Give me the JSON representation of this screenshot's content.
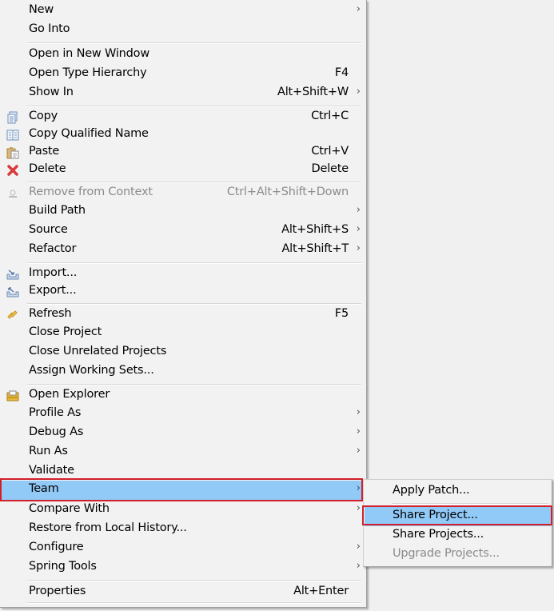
{
  "context_menu": {
    "items": [
      {
        "label": "New",
        "shortcut": "",
        "submenu": true,
        "icon": null,
        "disabled": false
      },
      {
        "label": "Go Into",
        "shortcut": "",
        "submenu": false,
        "icon": null,
        "disabled": false
      },
      {
        "label": "Open in New Window",
        "shortcut": "",
        "submenu": false,
        "icon": null,
        "disabled": false
      },
      {
        "label": "Open Type Hierarchy",
        "shortcut": "F4",
        "submenu": false,
        "icon": null,
        "disabled": false
      },
      {
        "label": "Show In",
        "shortcut": "Alt+Shift+W",
        "submenu": true,
        "icon": null,
        "disabled": false
      },
      {
        "label": "Copy",
        "shortcut": "Ctrl+C",
        "submenu": false,
        "icon": "copy-icon",
        "disabled": false
      },
      {
        "label": "Copy Qualified Name",
        "shortcut": "",
        "submenu": false,
        "icon": "copy-qualified-name-icon",
        "disabled": false
      },
      {
        "label": "Paste",
        "shortcut": "Ctrl+V",
        "submenu": false,
        "icon": "paste-icon",
        "disabled": false
      },
      {
        "label": "Delete",
        "shortcut": "Delete",
        "submenu": false,
        "icon": "delete-icon",
        "disabled": false
      },
      {
        "label": "Remove from Context",
        "shortcut": "Ctrl+Alt+Shift+Down",
        "submenu": false,
        "icon": "remove-from-context-icon",
        "disabled": true
      },
      {
        "label": "Build Path",
        "shortcut": "",
        "submenu": true,
        "icon": null,
        "disabled": false
      },
      {
        "label": "Source",
        "shortcut": "Alt+Shift+S",
        "submenu": true,
        "icon": null,
        "disabled": false
      },
      {
        "label": "Refactor",
        "shortcut": "Alt+Shift+T",
        "submenu": true,
        "icon": null,
        "disabled": false
      },
      {
        "label": "Import...",
        "shortcut": "",
        "submenu": false,
        "icon": "import-icon",
        "disabled": false
      },
      {
        "label": "Export...",
        "shortcut": "",
        "submenu": false,
        "icon": "export-icon",
        "disabled": false
      },
      {
        "label": "Refresh",
        "shortcut": "F5",
        "submenu": false,
        "icon": "refresh-icon",
        "disabled": false
      },
      {
        "label": "Close Project",
        "shortcut": "",
        "submenu": false,
        "icon": null,
        "disabled": false
      },
      {
        "label": "Close Unrelated Projects",
        "shortcut": "",
        "submenu": false,
        "icon": null,
        "disabled": false
      },
      {
        "label": "Assign Working Sets...",
        "shortcut": "",
        "submenu": false,
        "icon": null,
        "disabled": false
      },
      {
        "label": "Open Explorer",
        "shortcut": "",
        "submenu": false,
        "icon": "open-explorer-icon",
        "disabled": false
      },
      {
        "label": "Profile As",
        "shortcut": "",
        "submenu": true,
        "icon": null,
        "disabled": false
      },
      {
        "label": "Debug As",
        "shortcut": "",
        "submenu": true,
        "icon": null,
        "disabled": false
      },
      {
        "label": "Run As",
        "shortcut": "",
        "submenu": true,
        "icon": null,
        "disabled": false
      },
      {
        "label": "Validate",
        "shortcut": "",
        "submenu": false,
        "icon": null,
        "disabled": false
      },
      {
        "label": "Team",
        "shortcut": "",
        "submenu": true,
        "icon": null,
        "disabled": false,
        "highlighted": true
      },
      {
        "label": "Compare With",
        "shortcut": "",
        "submenu": true,
        "icon": null,
        "disabled": false
      },
      {
        "label": "Restore from Local History...",
        "shortcut": "",
        "submenu": false,
        "icon": null,
        "disabled": false
      },
      {
        "label": "Configure",
        "shortcut": "",
        "submenu": true,
        "icon": null,
        "disabled": false
      },
      {
        "label": "Spring Tools",
        "shortcut": "",
        "submenu": true,
        "icon": null,
        "disabled": false
      },
      {
        "label": "Properties",
        "shortcut": "Alt+Enter",
        "submenu": false,
        "icon": null,
        "disabled": false
      }
    ]
  },
  "team_submenu": {
    "items": [
      {
        "label": "Apply Patch...",
        "disabled": false
      },
      {
        "label": "Share Project...",
        "disabled": false,
        "highlighted": true
      },
      {
        "label": "Share Projects...",
        "disabled": false
      },
      {
        "label": "Upgrade Projects...",
        "disabled": true
      }
    ]
  },
  "colors": {
    "highlight": "#91c9f7",
    "annotation_box": "#d1202a",
    "disabled_text": "#8b8b8b"
  },
  "arrow_glyph": "›"
}
